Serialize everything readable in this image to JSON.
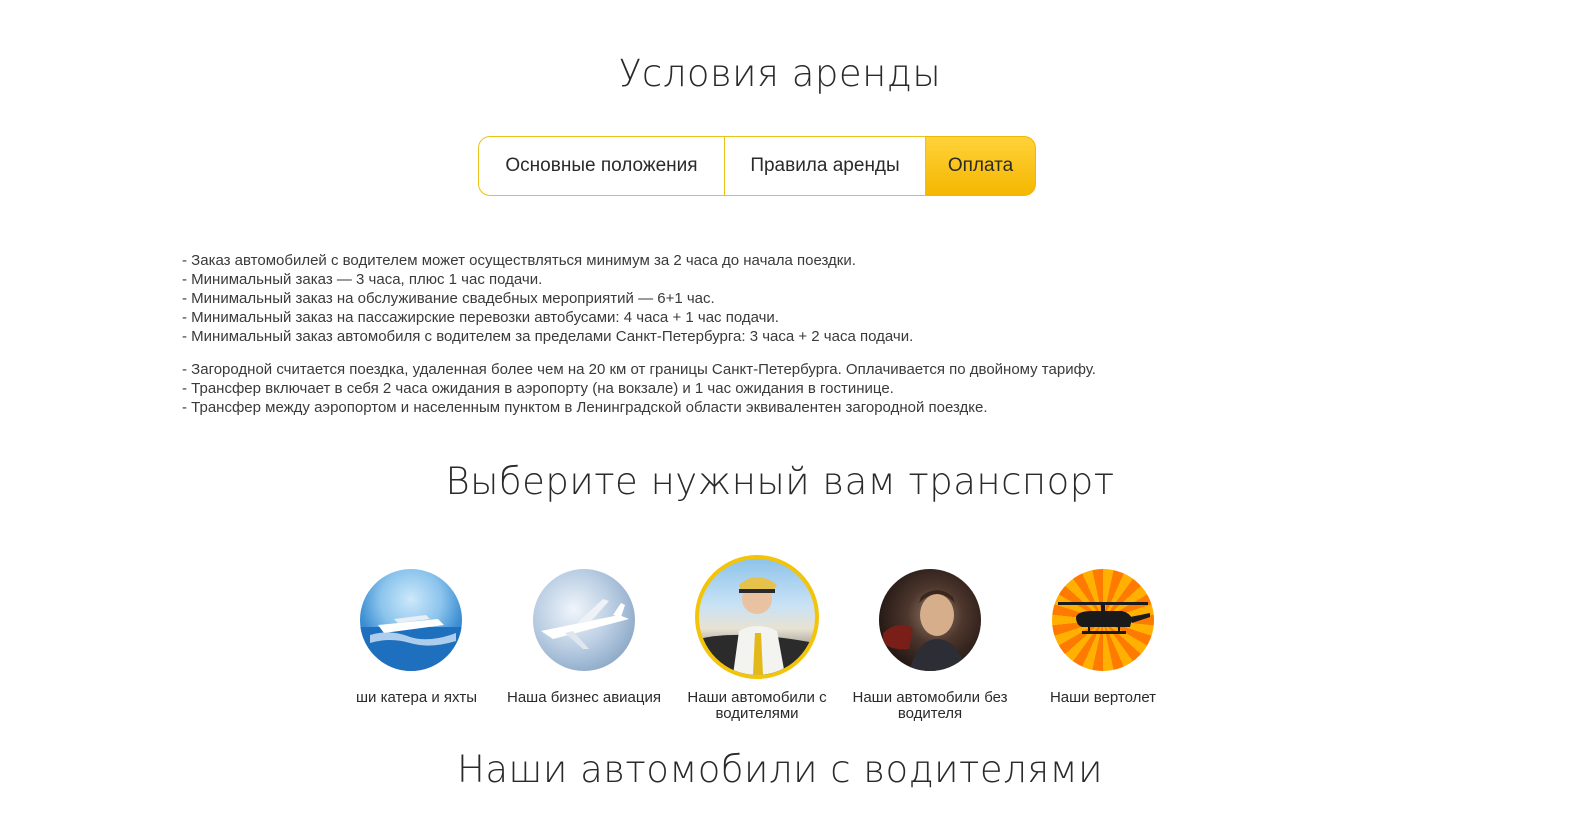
{
  "headings": {
    "conditions": "Условия аренды",
    "choose": "Выберите нужный вам транспорт",
    "cars": "Наши автомобили с водителями"
  },
  "tabs": [
    {
      "label": "Основные положения",
      "active": false
    },
    {
      "label": "Правила аренды",
      "active": false
    },
    {
      "label": "Оплата",
      "active": true
    }
  ],
  "accent_color": "#f5b700",
  "rules_group1": [
    "- Заказ автомобилей с водителем может осуществляться минимум за 2 часа до начала поездки.",
    "- Минимальный заказ — 3 часа, плюс 1 час подачи.",
    "- Минимальный заказ на обслуживание свадебных мероприятий — 6+1 час.",
    "- Минимальный заказ на пассажирские перевозки автобусами: 4 часа + 1 час подачи.",
    "- Минимальный заказ автомобиля с водителем за пределами Санкт-Петербурга: 3 часа + 2 часа подачи."
  ],
  "rules_group2": [
    "- Загородной считается поездка, удаленная более чем на 20 км от границы Санкт-Петербурга. Оплачивается по двойному тарифу.",
    "- Трансфер включает в себя 2 часа ожидания в аэропорту (на вокзале) и 1 час ожидания в гостинице.",
    "- Трансфер между аэропортом и населенным пунктом в Ленинградской области эквивалентен загородной поездке."
  ],
  "transport": [
    {
      "label": "ши катера и яхты",
      "icon": "yacht-icon",
      "active": false
    },
    {
      "label": "Наша бизнес авиация",
      "icon": "jet-icon",
      "active": false
    },
    {
      "label": "Наши автомобили с водителями",
      "icon": "chauffeur-icon",
      "active": true
    },
    {
      "label": "Наши автомобили без водителя",
      "icon": "driver-icon",
      "active": false
    },
    {
      "label": "Наши вертолет",
      "icon": "helicopter-icon",
      "active": false
    }
  ]
}
